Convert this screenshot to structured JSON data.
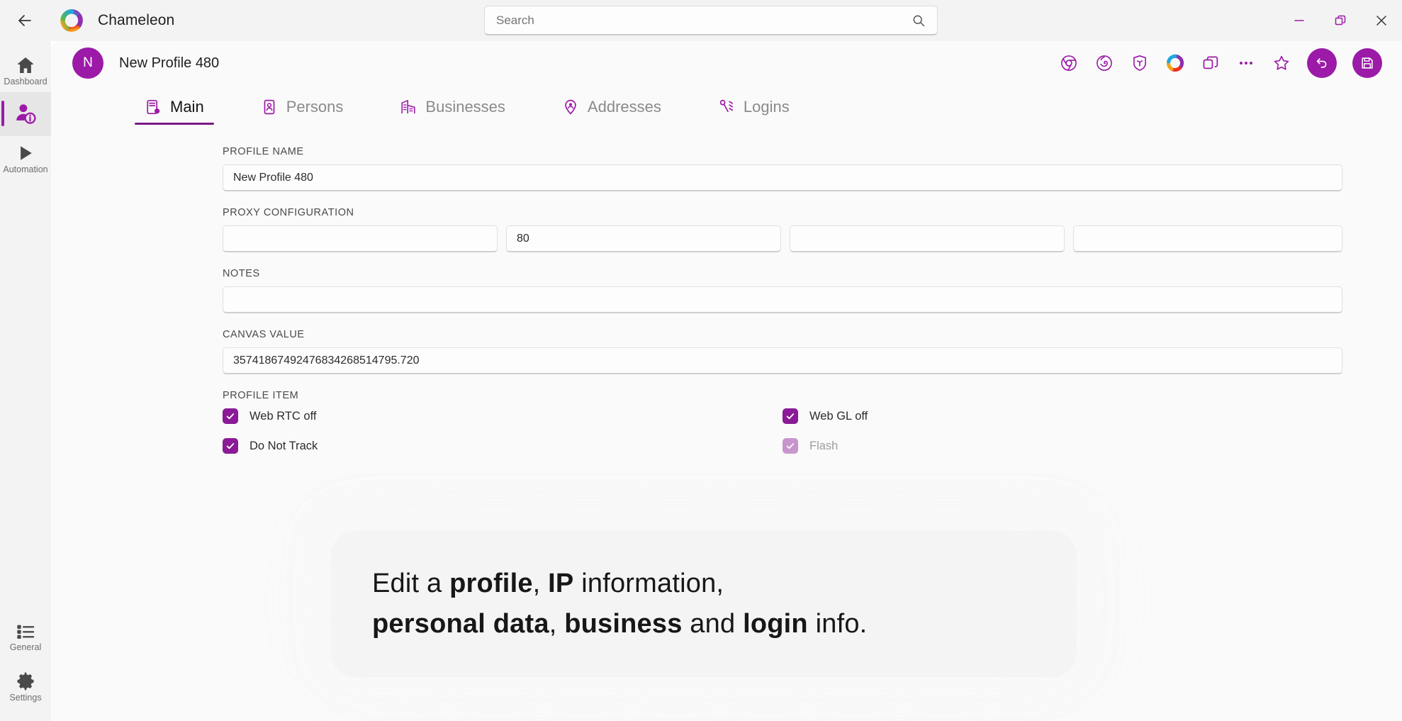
{
  "window": {
    "app_title": "Chameleon",
    "back_icon": "back-arrow-icon",
    "logo_icon": "chameleon-logo-icon",
    "minimize_label": "—",
    "restore_label": "Restore",
    "close_label": "Close",
    "accent_color": "#9c1aa8"
  },
  "search": {
    "placeholder": "Search",
    "value": "",
    "icon": "search-icon"
  },
  "sidebar": {
    "items": [
      {
        "label": "Dashboard",
        "icon": "home-icon",
        "active": false
      },
      {
        "label": "",
        "icon": "profile-info-icon",
        "active": true
      },
      {
        "label": "Automation",
        "icon": "play-icon",
        "active": false
      }
    ],
    "bottom_items": [
      {
        "label": "General",
        "icon": "list-icon"
      },
      {
        "label": "Settings",
        "icon": "gear-icon"
      }
    ]
  },
  "profile_header": {
    "avatar_initial": "N",
    "title": "New Profile 480",
    "tools": [
      {
        "name": "chrome-icon",
        "label": "Chrome"
      },
      {
        "name": "firefox-icon",
        "label": "Firefox"
      },
      {
        "name": "brave-icon",
        "label": "Brave"
      },
      {
        "name": "chameleon-browser-icon",
        "label": "Chameleon"
      },
      {
        "name": "duplicate-icon",
        "label": "Duplicate"
      },
      {
        "name": "more-options-icon",
        "label": "More"
      },
      {
        "name": "star-icon",
        "label": "Favorite"
      }
    ],
    "undo_label": "Undo",
    "save_label": "Save"
  },
  "tabs": [
    {
      "label": "Main",
      "icon": "main-tab-icon",
      "active": true
    },
    {
      "label": "Persons",
      "icon": "persons-tab-icon",
      "active": false
    },
    {
      "label": "Businesses",
      "icon": "businesses-tab-icon",
      "active": false
    },
    {
      "label": "Addresses",
      "icon": "addresses-tab-icon",
      "active": false
    },
    {
      "label": "Logins",
      "icon": "logins-tab-icon",
      "active": false
    }
  ],
  "form": {
    "profile_name": {
      "label": "PROFILE NAME",
      "value": "New Profile 480",
      "placeholder": ""
    },
    "proxy": {
      "label": "PROXY CONFIGURATION",
      "fields": [
        {
          "value": "",
          "placeholder": ""
        },
        {
          "value": "80",
          "placeholder": ""
        },
        {
          "value": "",
          "placeholder": ""
        },
        {
          "value": "",
          "placeholder": ""
        }
      ]
    },
    "notes": {
      "label": "NOTES",
      "value": "",
      "placeholder": ""
    },
    "canvas_value": {
      "label": "CANVAS VALUE",
      "value": "35741867492476834268514795.720",
      "placeholder": ""
    },
    "profile_item": {
      "label": "PROFILE ITEM",
      "left_column": [
        {
          "label": "Web RTC off",
          "checked": true
        },
        {
          "label": "Do Not Track",
          "checked": true
        }
      ],
      "right_column": [
        {
          "label": "Web GL off",
          "checked": true
        },
        {
          "label": "Flash",
          "checked": true
        }
      ]
    }
  },
  "overlay": {
    "line1_part1": "Edit a ",
    "line1_bold1": "profile",
    "line1_part2": ", ",
    "line1_bold2": "IP",
    "line1_part3": " information,",
    "line2_bold1": "personal data",
    "line2_part1": ", ",
    "line2_bold2": "business",
    "line2_part2": " and ",
    "line2_bold3": "login",
    "line2_part3": " info."
  }
}
